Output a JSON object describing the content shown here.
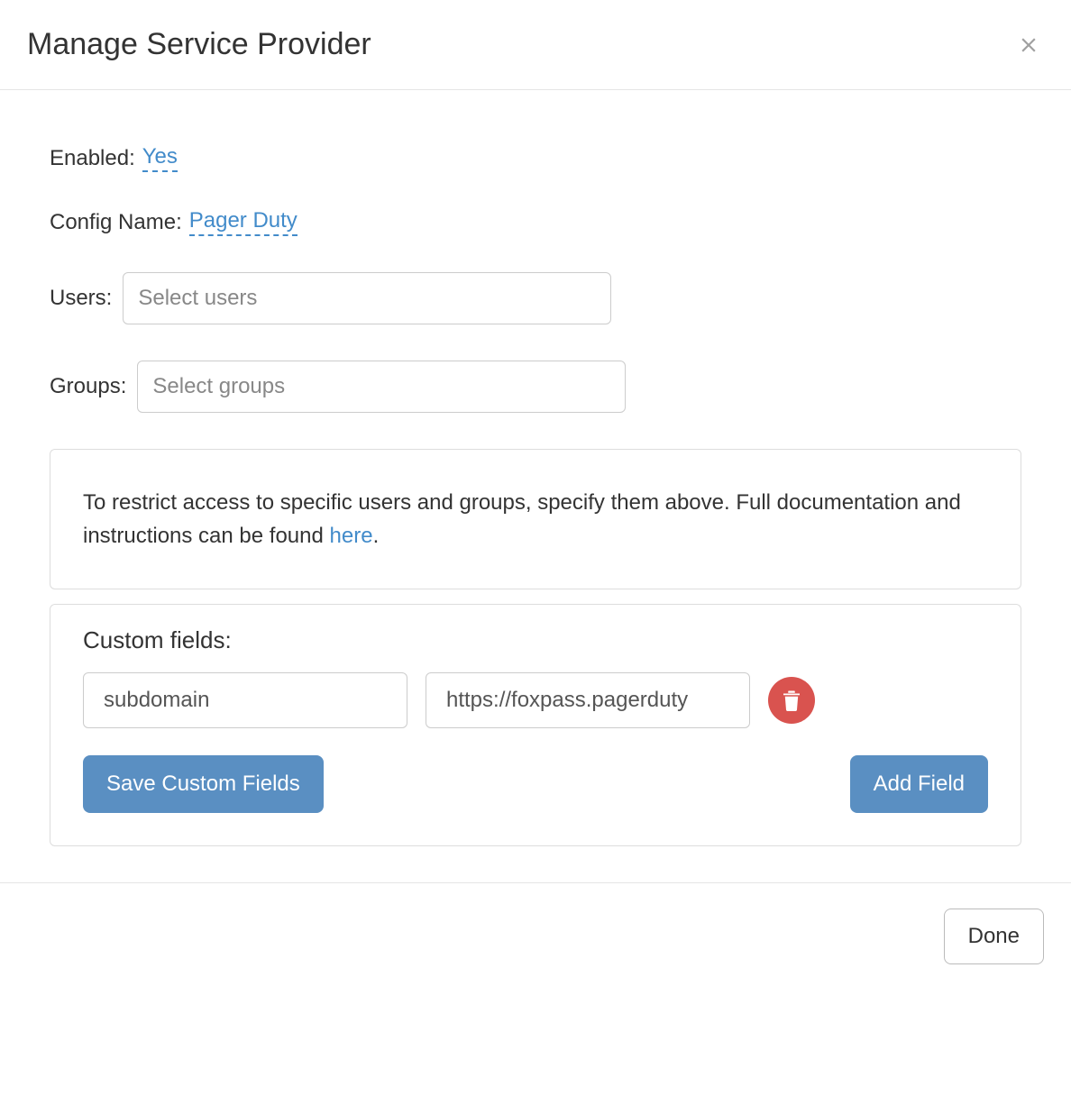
{
  "header": {
    "title": "Manage Service Provider"
  },
  "fields": {
    "enabled_label": "Enabled:",
    "enabled_value": "Yes",
    "config_name_label": "Config Name:",
    "config_name_value": "Pager Duty",
    "users_label": "Users:",
    "users_placeholder": "Select users",
    "groups_label": "Groups:",
    "groups_placeholder": "Select groups"
  },
  "info": {
    "text_before": "To restrict access to specific users and groups, specify them above. Full documentation and instructions can be found ",
    "link_text": "here",
    "text_after": "."
  },
  "custom_fields": {
    "title": "Custom fields:",
    "rows": [
      {
        "key": "subdomain",
        "value": "https://foxpass.pagerduty"
      }
    ],
    "save_label": "Save Custom Fields",
    "add_label": "Add Field"
  },
  "footer": {
    "done_label": "Done"
  }
}
